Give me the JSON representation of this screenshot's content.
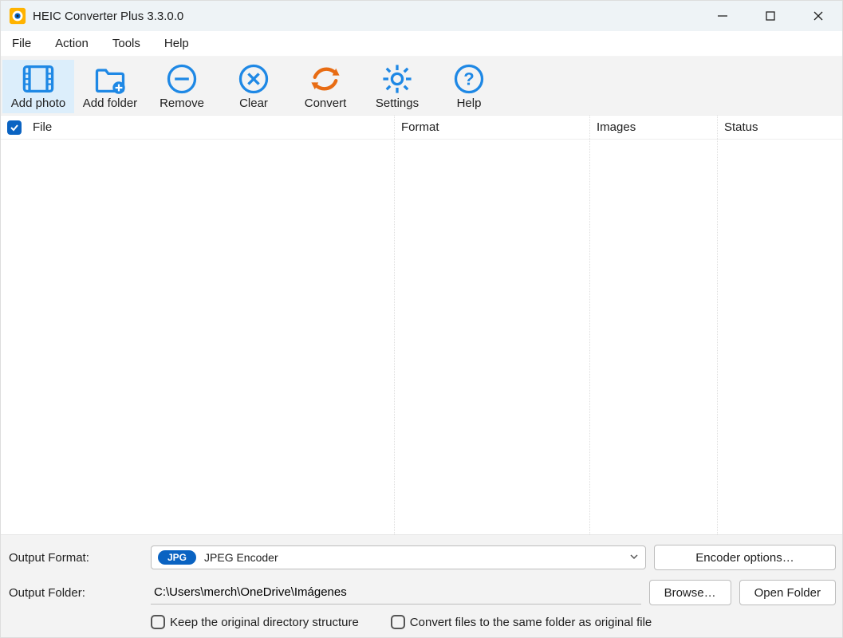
{
  "title": "HEIC Converter Plus 3.3.0.0",
  "menu": {
    "file": "File",
    "action": "Action",
    "tools": "Tools",
    "help": "Help"
  },
  "toolbar": {
    "addphoto": "Add photo",
    "addfolder": "Add folder",
    "remove": "Remove",
    "clear": "Clear",
    "convert": "Convert",
    "settings": "Settings",
    "help": "Help"
  },
  "columns": {
    "file": "File",
    "format": "Format",
    "images": "Images",
    "status": "Status"
  },
  "bottom": {
    "outfmt_label": "Output Format:",
    "outfmt_badge": "JPG",
    "outfmt_text": "JPEG Encoder",
    "encoderopts": "Encoder options…",
    "outfolder_label": "Output Folder:",
    "outfolder_value": "C:\\Users\\merch\\OneDrive\\Imágenes",
    "browse": "Browse…",
    "openfolder": "Open Folder",
    "keep": "Keep the original directory structure",
    "same": "Convert files to the same folder as original file"
  }
}
